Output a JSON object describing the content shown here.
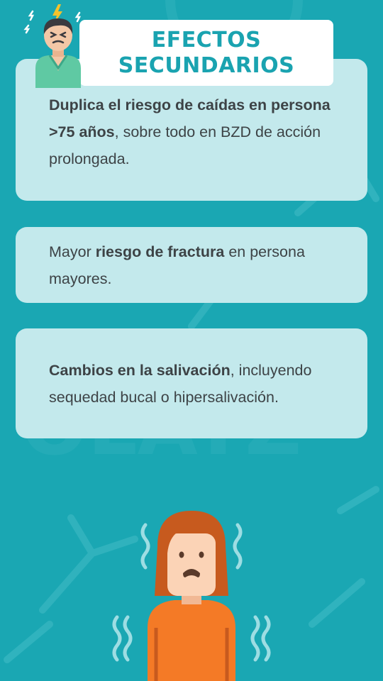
{
  "title": {
    "line1": "EFECTOS",
    "line2": "SECUNDARIOS"
  },
  "cards": [
    {
      "bold1": "Duplica el riesgo de caídas en persona >75 años",
      "text1": ", sobre todo en BZD de acción prolongada."
    },
    {
      "text0": "Mayor ",
      "bold1": "riesgo de fractura",
      "text1": " en persona mayores."
    },
    {
      "bold1": "Cambios en la salivación",
      "text1": ", incluyendo sequedad bucal o hipersalivación."
    }
  ],
  "colors": {
    "background": "#1aa7b3",
    "card": "#c3e9ec",
    "title": "#1aa3b0",
    "text": "#3d4346"
  },
  "icons": [
    "stressed-man-icon",
    "lightning-icon",
    "sparkle-icon",
    "trembling-woman-icon"
  ]
}
